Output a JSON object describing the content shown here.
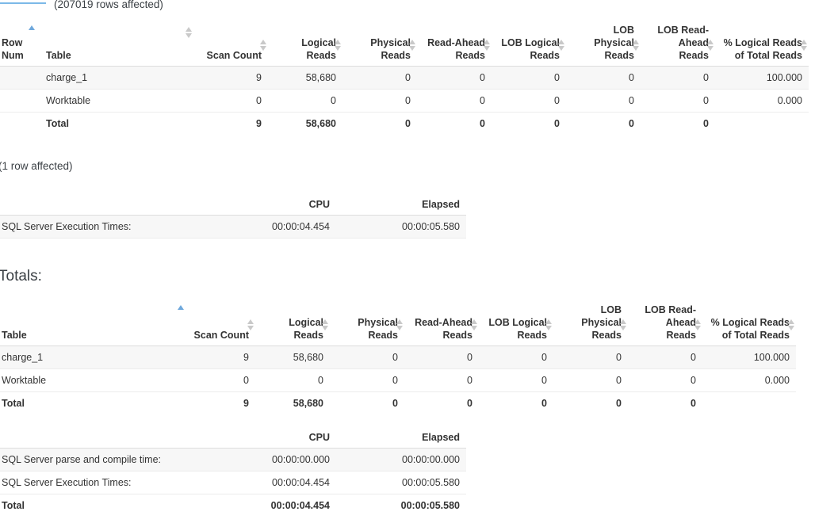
{
  "notices": {
    "rows_affected_main": "(207019 rows affected)",
    "rows_affected_second": "(1 row affected)"
  },
  "headings": {
    "totals": "Totals:"
  },
  "detail_table": {
    "columns": {
      "row_num": "Row Num",
      "table": "Table",
      "scan_count": "Scan Count",
      "logical_reads": "Logical Reads",
      "physical_reads": "Physical Reads",
      "read_ahead_reads": "Read-Ahead Reads",
      "lob_logical_reads": "LOB Logical Reads",
      "lob_physical_reads": "LOB Physical Reads",
      "lob_read_ahead_reads": "LOB Read-Ahead Reads",
      "pct_logical_reads": "% Logical Reads of Total Reads"
    },
    "sort": {
      "column": "row_num",
      "direction": "asc"
    },
    "rows": [
      {
        "row_num": "",
        "table": "charge_1",
        "scan_count": "9",
        "logical_reads": "58,680",
        "physical_reads": "0",
        "read_ahead_reads": "0",
        "lob_logical_reads": "0",
        "lob_physical_reads": "0",
        "lob_read_ahead_reads": "0",
        "pct_logical_reads": "100.000"
      },
      {
        "row_num": "",
        "table": "Worktable",
        "scan_count": "0",
        "logical_reads": "0",
        "physical_reads": "0",
        "read_ahead_reads": "0",
        "lob_logical_reads": "0",
        "lob_physical_reads": "0",
        "lob_read_ahead_reads": "0",
        "pct_logical_reads": "0.000"
      }
    ],
    "total": {
      "row_num": "",
      "table": "Total",
      "scan_count": "9",
      "logical_reads": "58,680",
      "physical_reads": "0",
      "read_ahead_reads": "0",
      "lob_logical_reads": "0",
      "lob_physical_reads": "0",
      "lob_read_ahead_reads": "0",
      "pct_logical_reads": ""
    }
  },
  "exec_times_table": {
    "columns": {
      "label": "",
      "cpu": "CPU",
      "elapsed": "Elapsed"
    },
    "rows": [
      {
        "label": "SQL Server Execution Times:",
        "cpu": "00:00:04.454",
        "elapsed": "00:00:05.580"
      }
    ]
  },
  "totals_table": {
    "columns": {
      "table": "Table",
      "scan_count": "Scan Count",
      "logical_reads": "Logical Reads",
      "physical_reads": "Physical Reads",
      "read_ahead_reads": "Read-Ahead Reads",
      "lob_logical_reads": "LOB Logical Reads",
      "lob_physical_reads": "LOB Physical Reads",
      "lob_read_ahead_reads": "LOB Read-Ahead Reads",
      "pct_logical_reads": "% Logical Reads of Total Reads"
    },
    "sort": {
      "column": "table",
      "direction": "asc"
    },
    "rows": [
      {
        "table": "charge_1",
        "scan_count": "9",
        "logical_reads": "58,680",
        "physical_reads": "0",
        "read_ahead_reads": "0",
        "lob_logical_reads": "0",
        "lob_physical_reads": "0",
        "lob_read_ahead_reads": "0",
        "pct_logical_reads": "100.000"
      },
      {
        "table": "Worktable",
        "scan_count": "0",
        "logical_reads": "0",
        "physical_reads": "0",
        "read_ahead_reads": "0",
        "lob_logical_reads": "0",
        "lob_physical_reads": "0",
        "lob_read_ahead_reads": "0",
        "pct_logical_reads": "0.000"
      }
    ],
    "total": {
      "table": "Total",
      "scan_count": "9",
      "logical_reads": "58,680",
      "physical_reads": "0",
      "read_ahead_reads": "0",
      "lob_logical_reads": "0",
      "lob_physical_reads": "0",
      "lob_read_ahead_reads": "0",
      "pct_logical_reads": ""
    }
  },
  "all_times_table": {
    "columns": {
      "label": "",
      "cpu": "CPU",
      "elapsed": "Elapsed"
    },
    "rows": [
      {
        "label": "SQL Server parse and compile time:",
        "cpu": "00:00:00.000",
        "elapsed": "00:00:00.000"
      },
      {
        "label": "SQL Server Execution Times:",
        "cpu": "00:00:04.454",
        "elapsed": "00:00:05.580"
      }
    ],
    "total": {
      "label": "Total",
      "cpu": "00:00:04.454",
      "elapsed": "00:00:05.580"
    }
  },
  "colors": {
    "accent_rule": "#7cb9e8",
    "sort_active": "#6fa8dc",
    "sort_inactive": "#c9c9c9",
    "row_shade": "#f7f7f7",
    "header_border": "#dddddd"
  }
}
